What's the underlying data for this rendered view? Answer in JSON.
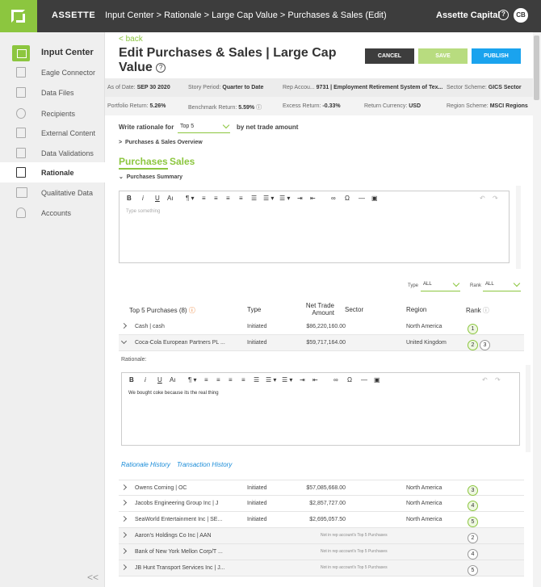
{
  "header": {
    "brand": "ASSETTE",
    "breadcrumb": "Input Center > Rationale > Large Cap Value > Purchases & Sales (Edit)",
    "org": "Assette Capital",
    "help_icon": "?",
    "avatar": "CB"
  },
  "sidebar": {
    "title": "Input Center",
    "items": [
      {
        "label": "Eagle Connector",
        "icon": "connector-icon"
      },
      {
        "label": "Data Files",
        "icon": "file-icon"
      },
      {
        "label": "Recipients",
        "icon": "person-icon"
      },
      {
        "label": "External Content",
        "icon": "document-icon"
      },
      {
        "label": "Data Validations",
        "icon": "check-icon"
      },
      {
        "label": "Rationale",
        "icon": "rationale-icon"
      },
      {
        "label": "Qualitative Data",
        "icon": "book-icon"
      },
      {
        "label": "Accounts",
        "icon": "accounts-icon"
      }
    ],
    "collapse": "<<"
  },
  "page": {
    "back": "< back",
    "title": "Edit Purchases & Sales | Large Cap Value",
    "title_info": "?",
    "cancel": "CANCEL",
    "save": "SAVE",
    "publish": "PUBLISH"
  },
  "info1": {
    "as_of_label": "As of Date:",
    "as_of": "SEP 30 2020",
    "story_label": "Story Period:",
    "story": "Quarter to Date",
    "rep_label": "Rep Accou...",
    "rep": "9731 | Employment Retirement System of Tex...",
    "sector_label": "Sector Scheme:",
    "sector": "GICS Sector"
  },
  "info2": {
    "port_label": "Portfolio Return:",
    "port": "5.26%",
    "bench_label": "Benchmark Return:",
    "bench": "5.59%",
    "excess_label": "Excess Return:",
    "excess": "-0.33%",
    "currency_label": "Return Currency:",
    "currency": "USD",
    "region_label": "Region Scheme:",
    "region": "MSCI Regions"
  },
  "controls": {
    "write_for": "Write rationale for",
    "top_select": "Top 5",
    "by": "by net trade amount",
    "overview": "Purchases & Sales Overview",
    "tab_purchases": "Purchases",
    "tab_sales": "Sales",
    "summary": "Purchases Summary",
    "placeholder": "Type something",
    "type_label": "Type",
    "type_value": "ALL",
    "rank_label": "Rank",
    "rank_value": "ALL"
  },
  "editor": {
    "bold": "B",
    "italic": "i",
    "underline": "U",
    "font_size": "Aı",
    "paragraph": "¶ ▾",
    "align_left": "≡",
    "align_center": "≡",
    "align_right": "≡",
    "justify": "≡",
    "list_ul": "☰",
    "list_ol": "☰ ▾",
    "list_more": "☰ ▾",
    "indent": "⇥",
    "outdent": "⇤",
    "link": "∞",
    "omega": "Ω",
    "hr": "—",
    "image": "▣",
    "undo": "↶",
    "redo": "↷"
  },
  "table": {
    "headers": {
      "name": "Top 5 Purchases (8)",
      "type": "Type",
      "net_trade": "Net Trade Amount",
      "sector": "Sector",
      "region": "Region",
      "rank": "Rank"
    },
    "rows": [
      {
        "name": "Cash | cash",
        "type": "Initiated",
        "amount": "$86,220,160.00",
        "region": "North America",
        "rank": "1"
      },
      {
        "name": "Coca-Cola European Partners PL ...",
        "type": "Initiated",
        "amount": "$59,717,164.00",
        "region": "United Kingdom",
        "rank": "2",
        "rank2": "3"
      }
    ],
    "rationale_label": "Rationale:",
    "rationale_text": "We bought coke because its the real thing",
    "history_link": "Rationale History",
    "transaction_link": "Transaction History",
    "rows2": [
      {
        "name": "Owens Corning | OC",
        "type": "Initiated",
        "amount": "$57,085,668.00",
        "region": "North America",
        "rank": "3"
      },
      {
        "name": "Jacobs Engineering Group Inc | J",
        "type": "Initiated",
        "amount": "$2,857,727.00",
        "region": "North America",
        "rank": "4"
      },
      {
        "name": "SeaWorld Entertainment Inc | SE...",
        "type": "Initiated",
        "amount": "$2,695,057.50",
        "region": "North America",
        "rank": "5"
      }
    ],
    "not_in_top": "Not in rep account's Top 5 Purchases",
    "rows3": [
      {
        "name": "Aaron's Holdings Co Inc | AAN",
        "rank": "2"
      },
      {
        "name": "Bank of New York Mellon Corp/T ...",
        "rank": "4"
      },
      {
        "name": "JB Hunt Transport Services Inc | J...",
        "rank": "5"
      }
    ]
  }
}
